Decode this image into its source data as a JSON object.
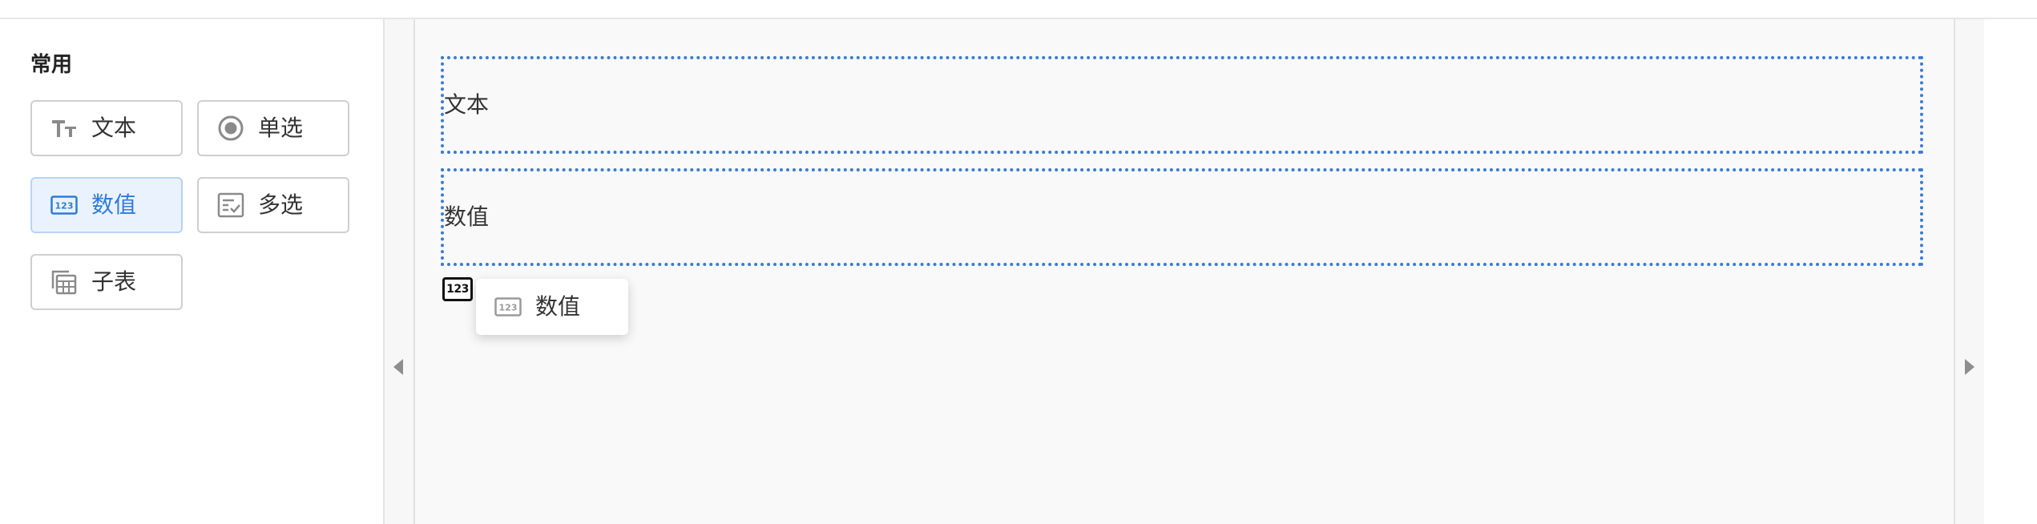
{
  "palette": {
    "section_title": "常用",
    "items": [
      {
        "label": "文本",
        "icon": "text-type-icon"
      },
      {
        "label": "单选",
        "icon": "radio-icon"
      },
      {
        "label": "数值",
        "icon": "number-icon",
        "selected": true
      },
      {
        "label": "多选",
        "icon": "checklist-icon"
      },
      {
        "label": "子表",
        "icon": "subtable-icon"
      }
    ]
  },
  "canvas": {
    "fields": [
      {
        "label": "文本"
      },
      {
        "label": "数值"
      }
    ],
    "drag_icon_text": "123",
    "drag_ghost": {
      "label": "数值",
      "icon": "number-icon"
    }
  },
  "icon_glyphs": {
    "number_text": "123"
  },
  "colors": {
    "accent": "#2f7bd9",
    "selected_bg": "#eaf3fd",
    "drop_border": "#3a7bd5"
  }
}
